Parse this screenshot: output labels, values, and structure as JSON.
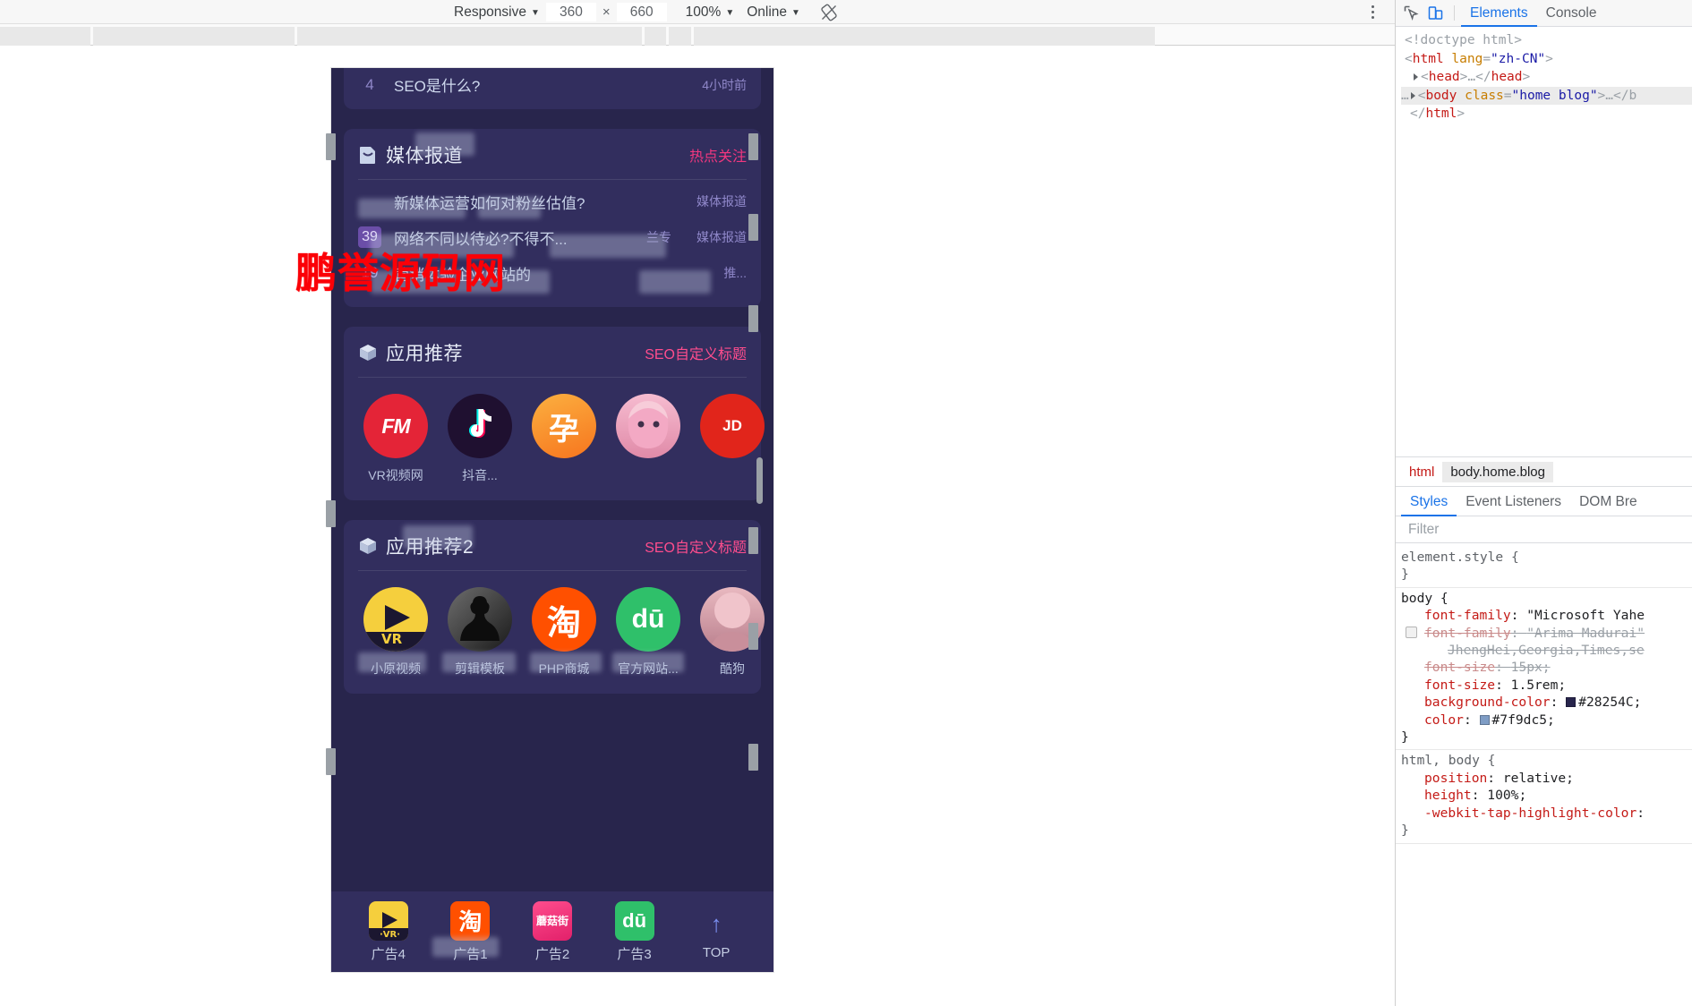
{
  "emulation_toolbar": {
    "device_label": "Responsive",
    "width": "360",
    "x_separator": "×",
    "height": "660",
    "zoom": "100%",
    "throttle": "Online",
    "rotate_icon": "rotate-device-icon",
    "more_icon": "more-options-icon",
    "caret": "▼"
  },
  "mobile_page": {
    "watermark": "鹏誉源码网",
    "top_partial_card": {
      "rank": "4",
      "title": "SEO是什么?",
      "tag": "4小时前"
    },
    "media_card": {
      "icon": "document-icon",
      "title": "媒体报道",
      "more_label": "热点关注",
      "rows": [
        {
          "rank": "",
          "text": "新媒体运营如何对粉丝估值?",
          "tag": "媒体报道"
        },
        {
          "rank": "39",
          "text": "网络不同以待必?不得不...",
          "tag": "兰专",
          "tag2": "媒体报道"
        },
        {
          "rank": "19",
          "text": "营销体验企业网站的",
          "tag": "推..."
        }
      ]
    },
    "apps_card_1": {
      "icon": "box-icon",
      "title": "应用推荐",
      "more_label": "SEO自定义标题",
      "apps": [
        {
          "name": "蜻蜓FM",
          "label": "VR视频网",
          "icon": "qingting-fm-icon",
          "color": "#e42437"
        },
        {
          "name": "抖音",
          "label": "抖音...",
          "icon": "douyin-icon",
          "color": "#1f1030"
        },
        {
          "name": "孕育",
          "label": "",
          "icon": "yunyu-icon",
          "color": "#f7901e"
        },
        {
          "name": "动漫",
          "label": "",
          "icon": "anime-avatar-icon",
          "color": "#f0a8bc"
        },
        {
          "name": "京东",
          "label": "",
          "icon": "jd-icon",
          "color": "#e1251b"
        }
      ]
    },
    "apps_card_2": {
      "icon": "box-icon",
      "title": "应用推荐2",
      "more_label": "SEO自定义标题",
      "apps": [
        {
          "name": "VR视频",
          "label": "小原视频",
          "icon": "vr-play-icon",
          "color": "#f5cf3d"
        },
        {
          "name": "剪辑模板",
          "label": "剪辑模板",
          "icon": "silhouette-icon",
          "color": "#3a3a3a"
        },
        {
          "name": "淘宝",
          "label": "PHP商城",
          "icon": "taobao-icon",
          "color": "#ff5000"
        },
        {
          "name": "百度",
          "label": "官方网站...",
          "icon": "baidu-icon",
          "color": "#2fc06a"
        },
        {
          "name": "酷狗",
          "label": "酷狗",
          "icon": "kugou-avatar-icon",
          "color": "#d89aa2"
        }
      ]
    },
    "ad_bar": {
      "items": [
        {
          "label": "广告4",
          "icon": "vr-play-icon",
          "color": "#f5cf3d"
        },
        {
          "label": "广告1",
          "icon": "taobao-icon",
          "color": "#ff5000"
        },
        {
          "label": "广告2",
          "icon": "mogujie-icon",
          "color": "#ef2d72"
        },
        {
          "label": "广告3",
          "icon": "baidu-icon",
          "color": "#2fc06a"
        }
      ],
      "top_button": {
        "label": "TOP",
        "icon": "arrow-up-icon",
        "arrow": "↑"
      }
    }
  },
  "devtools": {
    "inspect_icon": "inspect-element-icon",
    "device_toggle_icon": "device-toolbar-icon",
    "tabs": [
      {
        "label": "Elements",
        "active": true
      },
      {
        "label": "Console",
        "active": false
      }
    ],
    "dom": {
      "line1": "<!doctype html>",
      "line2_open": "<html",
      "line2_attr": "lang",
      "line2_eq": "=",
      "line2_val": "\"zh-CN\"",
      "line2_close": ">",
      "line3": "<head>…</head>",
      "line4_open": "<body",
      "line4_attr": "class",
      "line4_eq": "=",
      "line4_val": "\"home blog\"",
      "line4_close": ">…</b",
      "line5": "</html>",
      "ellipsis": "…"
    },
    "breadcrumb": [
      {
        "label": "html",
        "active": false
      },
      {
        "label": "body.home.blog",
        "active": true
      }
    ],
    "side_tabs": [
      {
        "label": "Styles",
        "active": true
      },
      {
        "label": "Event Listeners",
        "active": false
      },
      {
        "label": "DOM Bre",
        "active": false
      }
    ],
    "filter_placeholder": "Filter",
    "styles": {
      "element_style": {
        "selector": "element.style {",
        "close": "}"
      },
      "body_rule": {
        "selector": "body {",
        "close": "}",
        "props": [
          {
            "name": "font-family",
            "value": "\"Microsoft Yahe",
            "strike": false,
            "checkbox": false
          },
          {
            "name": "font-family",
            "value": "\"Arima Madurai\"",
            "strike": true,
            "checkbox": true
          },
          {
            "cont": "JhengHei,Georgia,Times,se",
            "strike": true
          },
          {
            "name": "font-size",
            "value": "15px;",
            "strike": true,
            "checkbox": false
          },
          {
            "name": "font-size",
            "value": "1.5rem;",
            "strike": false,
            "checkbox": false
          },
          {
            "name": "background-color",
            "value": "#28254C;",
            "swatch": "#28254C",
            "strike": false,
            "checkbox": false
          },
          {
            "name": "color",
            "value": "#7f9dc5;",
            "swatch": "#7f9dc5",
            "strike": false,
            "checkbox": false
          }
        ]
      },
      "html_body_rule": {
        "selector": "html, body {",
        "close": "}",
        "props": [
          {
            "name": "position",
            "value": "relative;"
          },
          {
            "name": "height",
            "value": "100%;"
          },
          {
            "name": "-webkit-tap-highlight-color",
            "value": ":"
          }
        ]
      }
    }
  },
  "colors": {
    "page_bg": "#28254c",
    "card_bg": "#322e5e",
    "text": "#7f9dc5",
    "accent_pink": "#f2377f",
    "watermark_red": "#fb0007",
    "devtools_blue": "#1a73e8"
  }
}
